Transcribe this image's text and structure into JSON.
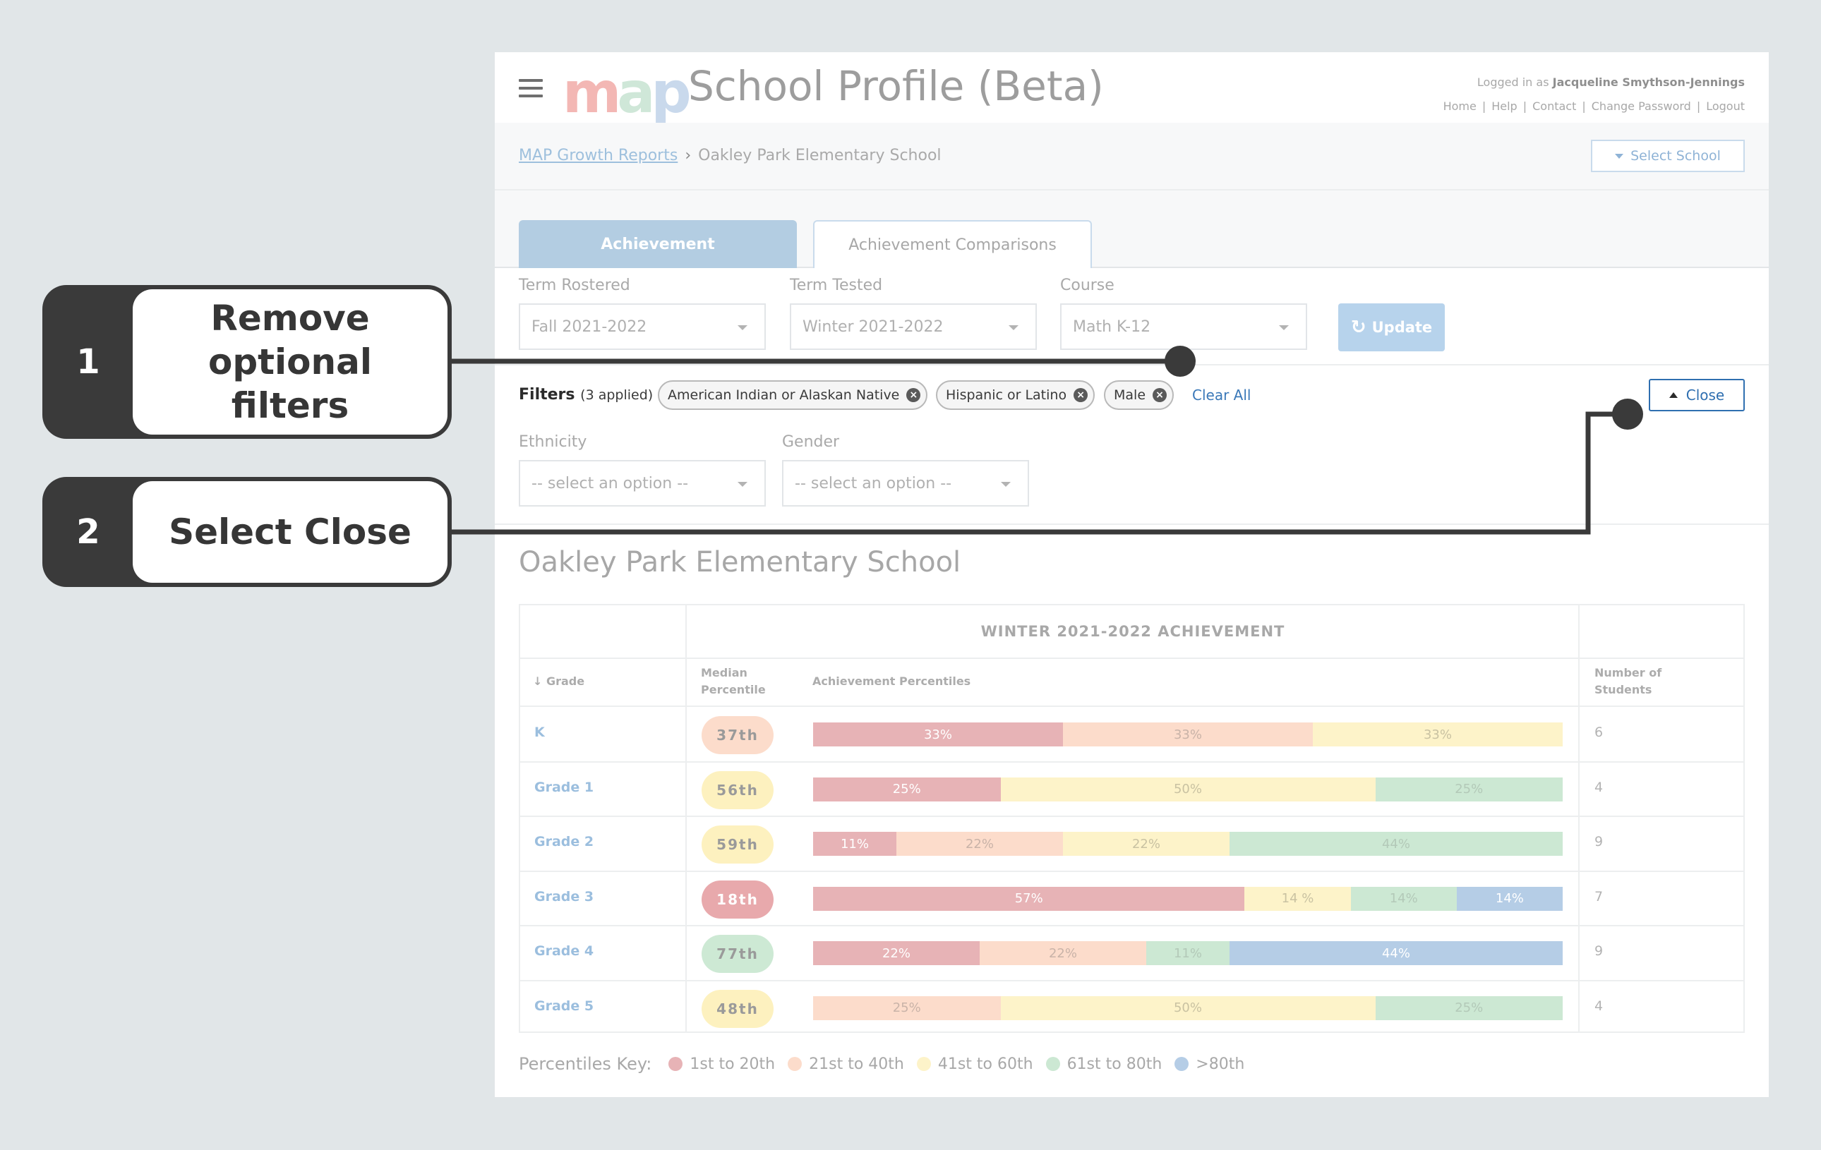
{
  "header": {
    "logo_text": "map",
    "app_title": "School Profile (Beta)",
    "logged_in_prefix": "Logged in as",
    "user_name": "Jacqueline Smythson-Jennings",
    "links": [
      "Home",
      "Help",
      "Contact",
      "Change Password",
      "Logout"
    ]
  },
  "breadcrumb": {
    "root": "MAP Growth Reports",
    "current": "Oakley Park Elementary School",
    "select_school_label": "Select School"
  },
  "tabs": [
    {
      "label": "Achievement",
      "active": true
    },
    {
      "label": "Achievement Comparisons",
      "active": false
    }
  ],
  "filters_top": {
    "term_rostered": {
      "label": "Term Rostered",
      "value": "Fall 2021-2022"
    },
    "term_tested": {
      "label": "Term Tested",
      "value": "Winter 2021-2022"
    },
    "course": {
      "label": "Course",
      "value": "Math K-12"
    },
    "update_label": "Update"
  },
  "filters_applied": {
    "label": "Filters",
    "count_text": "(3 applied)",
    "chips": [
      "American Indian or Alaskan Native",
      "Hispanic or Latino",
      "Male"
    ],
    "clear_all": "Clear All",
    "close_label": "Close"
  },
  "extra_filters": {
    "ethnicity": {
      "label": "Ethnicity",
      "placeholder": "-- select an option --"
    },
    "gender": {
      "label": "Gender",
      "placeholder": "-- select an option --"
    }
  },
  "school_title": "Oakley Park Elementary School",
  "table": {
    "group_header": "WINTER 2021-2022 ACHIEVEMENT",
    "col_grade": "Grade",
    "col_median_1": "Median",
    "col_median_2": "Percentile",
    "col_achievement": "Achievement Percentiles",
    "col_students_1": "Number of",
    "col_students_2": "Students",
    "rows": [
      {
        "grade": "K",
        "median": "37th",
        "median_band": 1,
        "students": "6",
        "segments": [
          {
            "pct": 33,
            "label": "33%",
            "band": 0
          },
          {
            "pct": 33,
            "label": "33%",
            "band": 1
          },
          {
            "pct": 33,
            "label": "33%",
            "band": 2
          }
        ]
      },
      {
        "grade": "Grade 1",
        "median": "56th",
        "median_band": 2,
        "students": "4",
        "segments": [
          {
            "pct": 25,
            "label": "25%",
            "band": 0
          },
          {
            "pct": 50,
            "label": "50%",
            "band": 2
          },
          {
            "pct": 25,
            "label": "25%",
            "band": 3
          }
        ]
      },
      {
        "grade": "Grade 2",
        "median": "59th",
        "median_band": 2,
        "students": "9",
        "segments": [
          {
            "pct": 11,
            "label": "11%",
            "band": 0
          },
          {
            "pct": 22,
            "label": "22%",
            "band": 1
          },
          {
            "pct": 22,
            "label": "22%",
            "band": 2
          },
          {
            "pct": 44,
            "label": "44%",
            "band": 3
          }
        ]
      },
      {
        "grade": "Grade 3",
        "median": "18th",
        "median_band": 0,
        "students": "7",
        "segments": [
          {
            "pct": 57,
            "label": "57%",
            "band": 0
          },
          {
            "pct": 14,
            "label": "14 %",
            "band": 2
          },
          {
            "pct": 14,
            "label": "14%",
            "band": 3
          },
          {
            "pct": 14,
            "label": "14%",
            "band": 4
          }
        ]
      },
      {
        "grade": "Grade 4",
        "median": "77th",
        "median_band": 3,
        "students": "9",
        "segments": [
          {
            "pct": 22,
            "label": "22%",
            "band": 0
          },
          {
            "pct": 22,
            "label": "22%",
            "band": 1
          },
          {
            "pct": 11,
            "label": "11%",
            "band": 3
          },
          {
            "pct": 44,
            "label": "44%",
            "band": 4
          }
        ]
      },
      {
        "grade": "Grade 5",
        "median": "48th",
        "median_band": 2,
        "students": "4",
        "segments": [
          {
            "pct": 25,
            "label": "25%",
            "band": 1
          },
          {
            "pct": 50,
            "label": "50%",
            "band": 2
          },
          {
            "pct": 25,
            "label": "25%",
            "band": 3
          }
        ]
      }
    ]
  },
  "key": {
    "label": "Percentiles Key:",
    "items": [
      "1st to 20th",
      "21st to 40th",
      "41st to 60th",
      "61st to 80th",
      ">80th"
    ]
  },
  "colors": {
    "bands": [
      "#e7b3b6",
      "#fcdccb",
      "#fdf3c9",
      "#cce8d3",
      "#b5cde6"
    ],
    "band_text": [
      "#ffffff",
      "#c9b3a8",
      "#c9c2a2",
      "#b3c9b8",
      "#ffffff"
    ],
    "pill_bands": [
      "#e8a9ac",
      "#fcdccb",
      "#fdf1bf",
      "#cde9d4",
      "#b5cde6"
    ],
    "accent": "#2f6fb0"
  },
  "annotations": [
    {
      "number": "1",
      "text": "Remove optional filters"
    },
    {
      "number": "2",
      "text": "Select Close"
    }
  ]
}
